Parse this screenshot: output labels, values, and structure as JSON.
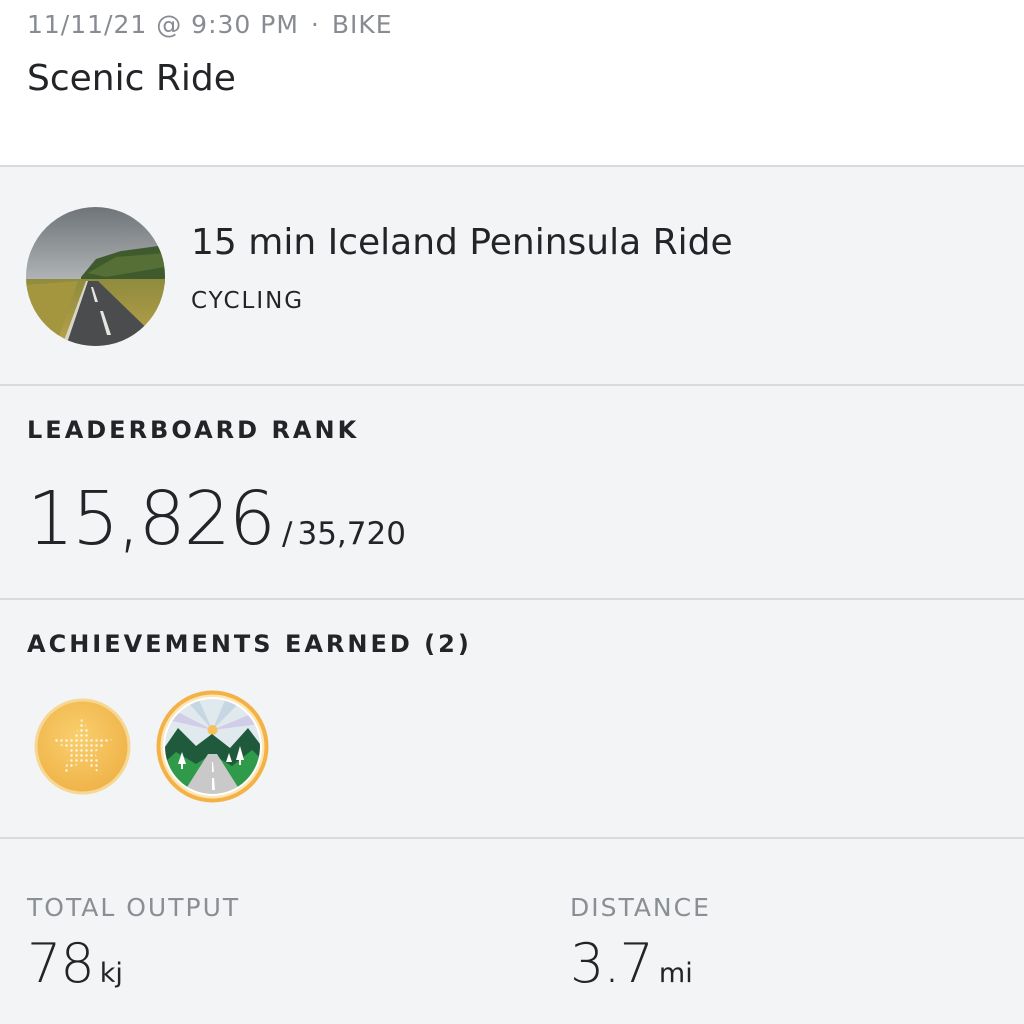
{
  "header": {
    "date_time": "11/11/21 @ 9:30 PM",
    "separator": "·",
    "discipline": "BIKE",
    "title": "Scenic Ride"
  },
  "class_info": {
    "title": "15 min Iceland Peninsula Ride",
    "type": "CYCLING",
    "thumbnail_icon": "iceland-road-photo"
  },
  "leaderboard": {
    "label": "LEADERBOARD RANK",
    "rank": "15,826",
    "separator": "/",
    "total": "35,720"
  },
  "achievements": {
    "label": "ACHIEVEMENTS EARNED (2)",
    "badges": [
      {
        "icon": "gold-star-badge-icon",
        "color": "#f2b94f"
      },
      {
        "icon": "scenic-road-badge-icon",
        "color": "#2e8b3f"
      }
    ]
  },
  "stats": {
    "output_label": "TOTAL OUTPUT",
    "output_value": "78",
    "output_unit": "kj",
    "distance_label": "DISTANCE",
    "distance_value": "3.7",
    "distance_unit": "mi"
  }
}
